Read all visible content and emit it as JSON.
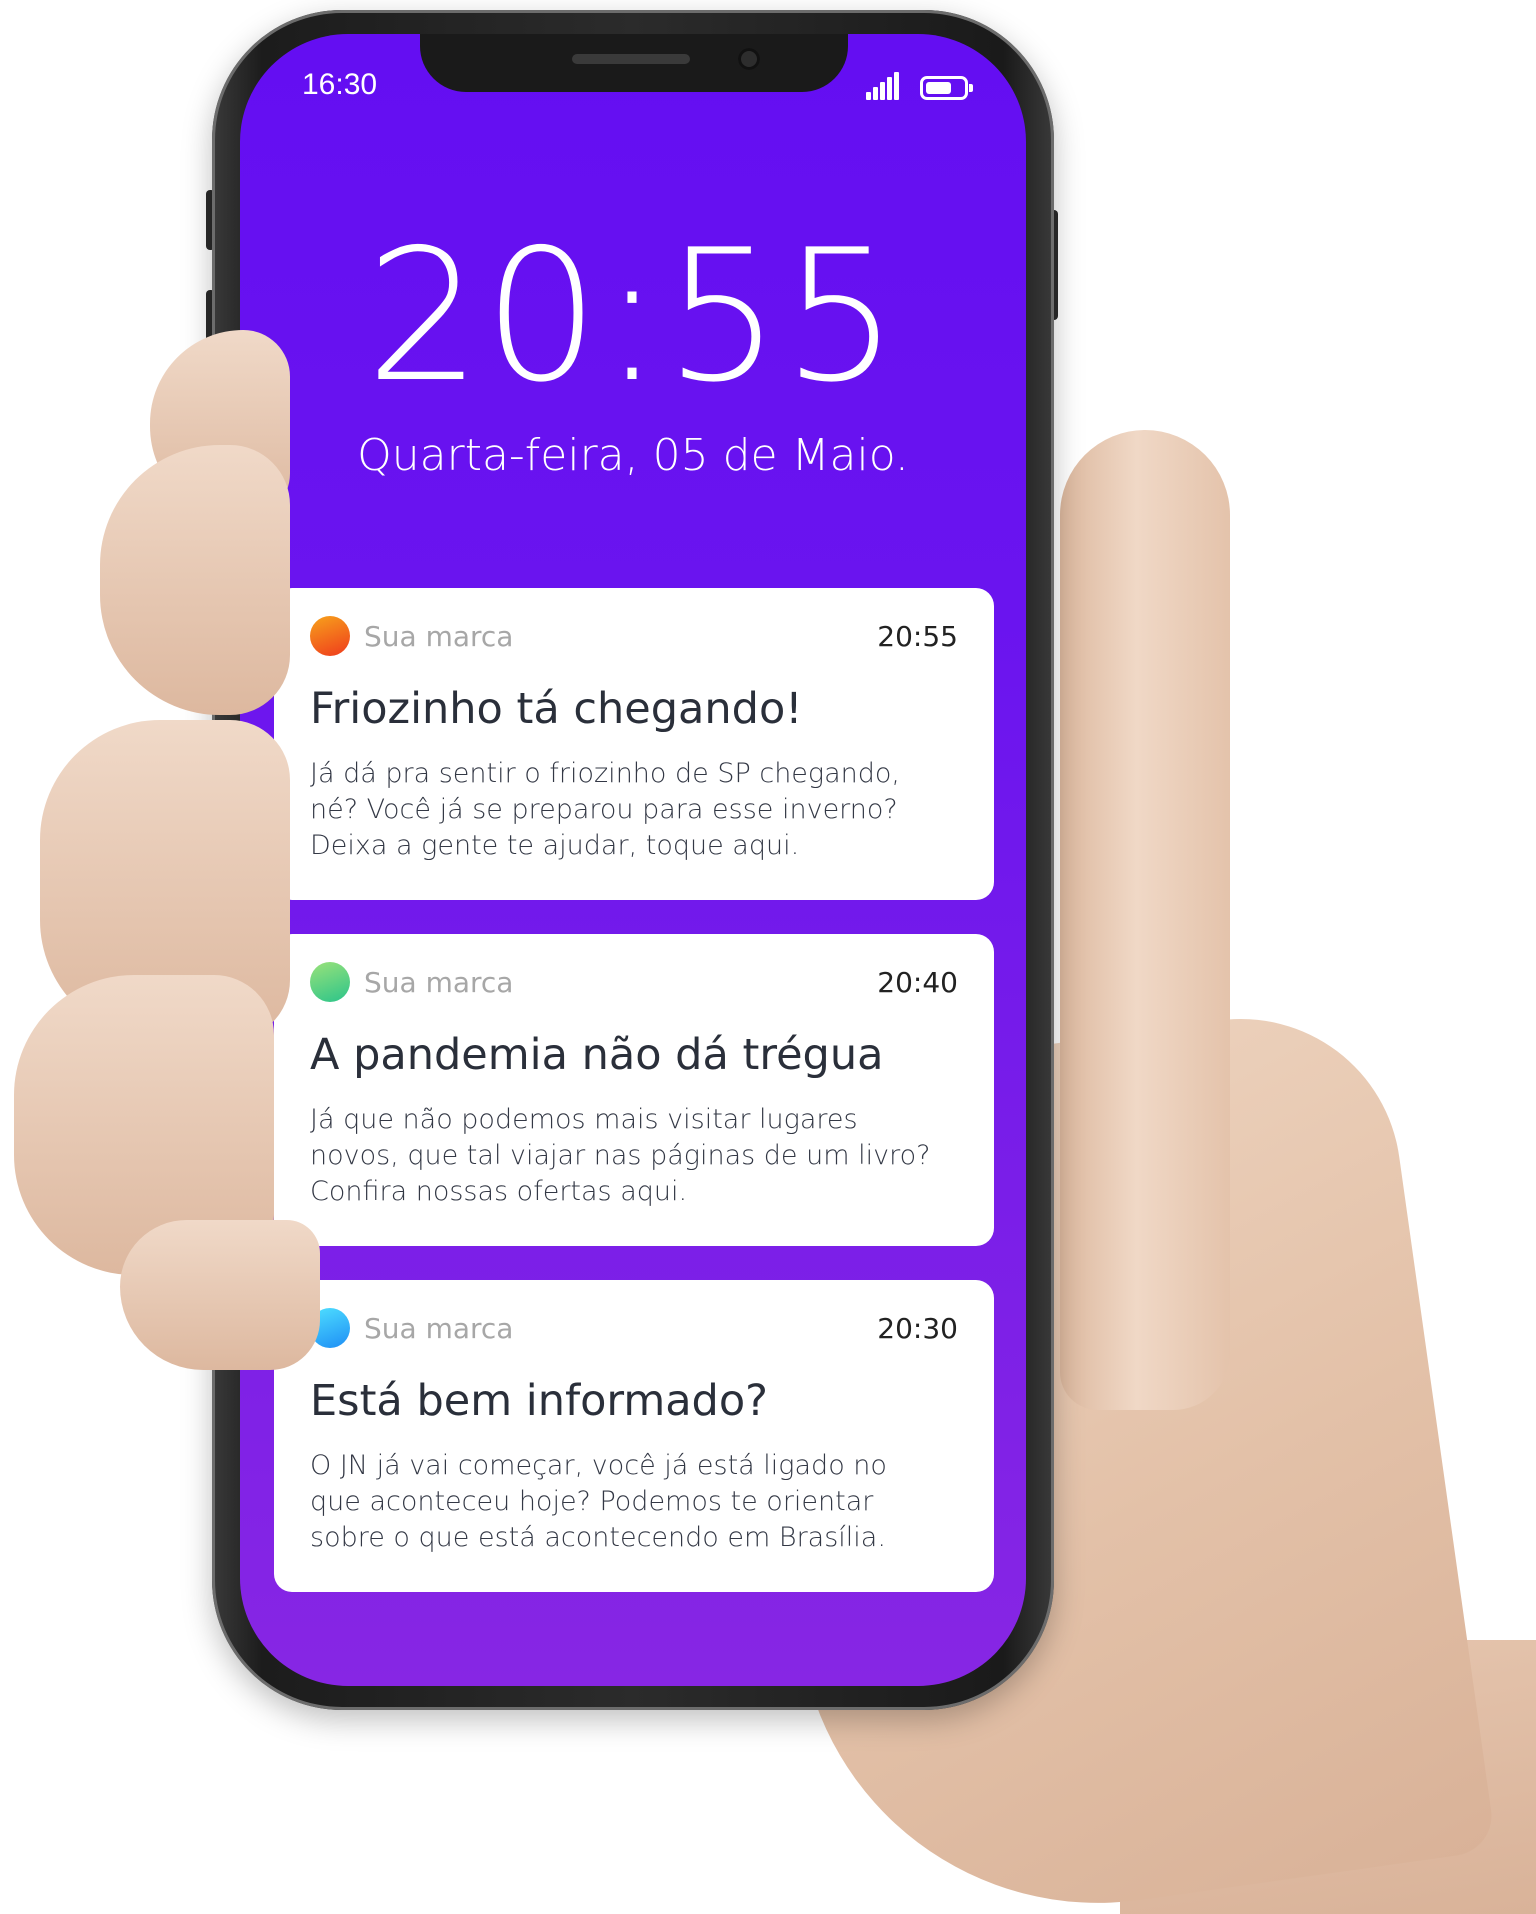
{
  "status_bar": {
    "time": "16:30",
    "signal_icon": "signal-bars-icon",
    "battery_icon": "battery-icon",
    "battery_level": 0.7
  },
  "lockscreen": {
    "clock": "20:55",
    "date": "Quarta-feira, 05 de Maio."
  },
  "colors": {
    "screen_top": "#640ef2",
    "screen_bottom": "#8726e4",
    "card": "#ffffff"
  },
  "notifications": [
    {
      "app": "Sua marca",
      "time": "20:55",
      "title": "Friozinho tá chegando!",
      "body_lines": [
        "Já dá pra sentir o friozinho de SP chegando,",
        "né? Você já se preparou para esse inverno?",
        "Deixa a gente te ajudar, toque aqui."
      ],
      "dot_colors": [
        "#f7a21b",
        "#ef3b1d"
      ]
    },
    {
      "app": "Sua marca",
      "time": "20:40",
      "title": "A pandemia não dá trégua",
      "body_lines": [
        "Já que não podemos mais visitar lugares",
        "novos, que tal viajar nas páginas de um livro?",
        "Confira nossas ofertas aqui."
      ],
      "dot_colors": [
        "#9ae27a",
        "#2bc48a"
      ]
    },
    {
      "app": "Sua marca",
      "time": "20:30",
      "title": "Está bem informado?",
      "body_lines": [
        "O JN já vai começar, você já está ligado no",
        "que aconteceu hoje? Podemos te orientar",
        "sobre o que está acontecendo em Brasília."
      ],
      "dot_colors": [
        "#4fe0ff",
        "#1e8ef5"
      ]
    }
  ]
}
